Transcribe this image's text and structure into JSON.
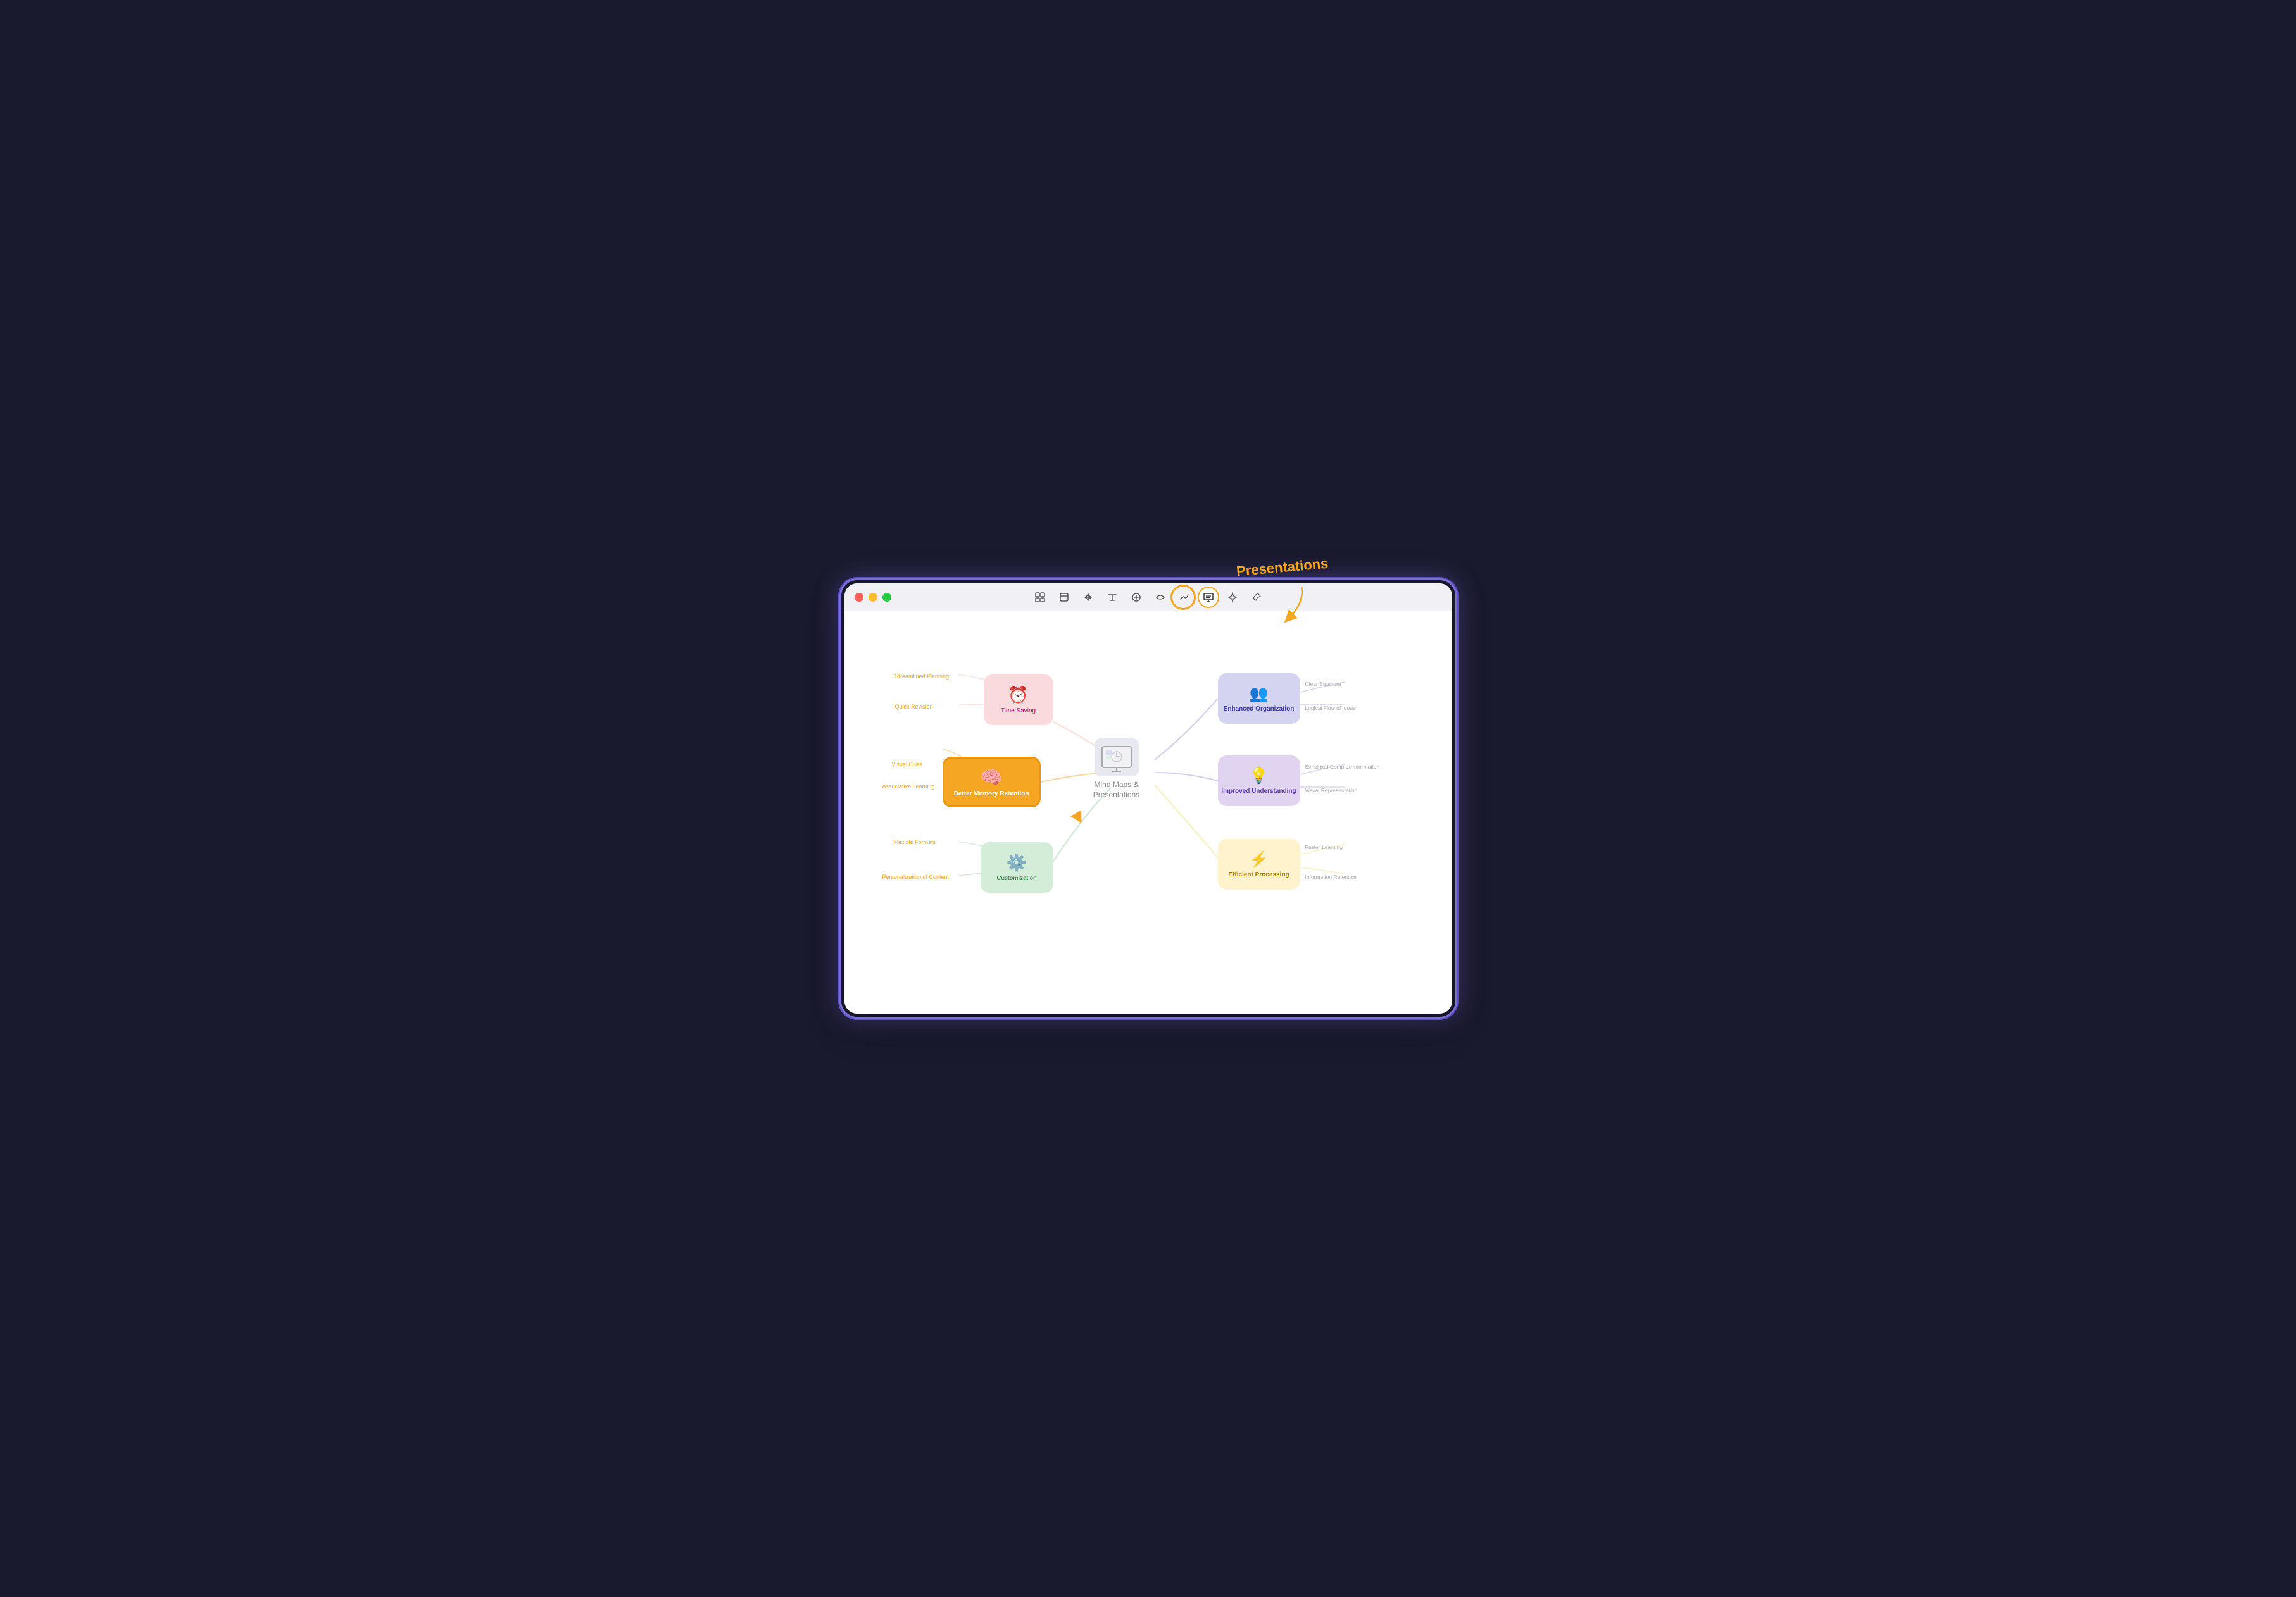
{
  "window": {
    "controls": {
      "close": "close",
      "minimize": "minimize",
      "maximize": "maximize"
    }
  },
  "toolbar": {
    "buttons": [
      {
        "id": "select",
        "icon": "⊡",
        "label": "Select"
      },
      {
        "id": "frame",
        "icon": "⊞",
        "label": "Frame"
      },
      {
        "id": "move",
        "icon": "↗",
        "label": "Move"
      },
      {
        "id": "text",
        "icon": "T",
        "label": "Text"
      },
      {
        "id": "add",
        "icon": "+",
        "label": "Add"
      },
      {
        "id": "connect",
        "icon": "⇌",
        "label": "Connect"
      },
      {
        "id": "path",
        "icon": "∿",
        "label": "Path"
      },
      {
        "id": "presentation",
        "icon": "▣",
        "label": "Presentation",
        "active": true
      },
      {
        "id": "ai",
        "icon": "✦",
        "label": "AI"
      },
      {
        "id": "pin",
        "icon": "⊕",
        "label": "Pin"
      }
    ]
  },
  "annotation": {
    "presentations_label": "Presentations",
    "arrow_direction": "down-left"
  },
  "mindmap": {
    "center": {
      "label": "Mind Maps\n&\nPresentations",
      "icon": "📊"
    },
    "nodes": {
      "better_memory": {
        "label": "Better Memory Retention",
        "icon": "🧠",
        "color": "#f5a623",
        "sub_labels": [
          "Visual Cues",
          "Associative Learning"
        ]
      },
      "time_saving": {
        "label": "Time Saving",
        "icon": "⏰",
        "color": "#fadadd",
        "sub_labels": [
          "Streamlined Planning",
          "Quick Revision"
        ]
      },
      "customization": {
        "label": "Customization",
        "icon": "⚙",
        "color": "#d4edd8",
        "sub_labels": [
          "Flexible Formats",
          "Personalization of Content"
        ]
      },
      "enhanced_org": {
        "label": "Enhanced Organization",
        "icon": "👥",
        "color": "#d4d4f0",
        "sub_labels": [
          "Clear Structure",
          "Logical Flow of Ideas"
        ]
      },
      "improved_understanding": {
        "label": "Improved Understanding",
        "icon": "💡",
        "color": "#e0d4f0",
        "sub_labels": [
          "Simplified Complex Information",
          "Visual Representation"
        ]
      },
      "efficient_processing": {
        "label": "Efficient Processing",
        "icon": "⚡",
        "color": "#fef3cc",
        "sub_labels": [
          "Faster Learning",
          "Information Retention"
        ]
      }
    }
  },
  "cursor": {
    "visible": true
  }
}
